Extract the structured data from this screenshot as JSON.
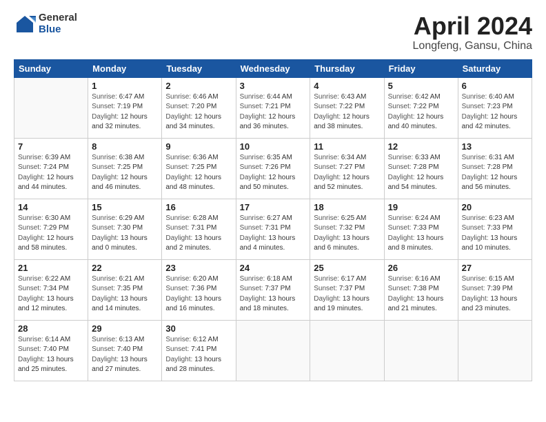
{
  "header": {
    "logo_general": "General",
    "logo_blue": "Blue",
    "title": "April 2024",
    "location": "Longfeng, Gansu, China"
  },
  "calendar": {
    "days_of_week": [
      "Sunday",
      "Monday",
      "Tuesday",
      "Wednesday",
      "Thursday",
      "Friday",
      "Saturday"
    ],
    "weeks": [
      [
        {
          "day": "",
          "sunrise": "",
          "sunset": "",
          "daylight": ""
        },
        {
          "day": "1",
          "sunrise": "6:47 AM",
          "sunset": "7:19 PM",
          "daylight": "12 hours and 32 minutes."
        },
        {
          "day": "2",
          "sunrise": "6:46 AM",
          "sunset": "7:20 PM",
          "daylight": "12 hours and 34 minutes."
        },
        {
          "day": "3",
          "sunrise": "6:44 AM",
          "sunset": "7:21 PM",
          "daylight": "12 hours and 36 minutes."
        },
        {
          "day": "4",
          "sunrise": "6:43 AM",
          "sunset": "7:22 PM",
          "daylight": "12 hours and 38 minutes."
        },
        {
          "day": "5",
          "sunrise": "6:42 AM",
          "sunset": "7:22 PM",
          "daylight": "12 hours and 40 minutes."
        },
        {
          "day": "6",
          "sunrise": "6:40 AM",
          "sunset": "7:23 PM",
          "daylight": "12 hours and 42 minutes."
        }
      ],
      [
        {
          "day": "7",
          "sunrise": "6:39 AM",
          "sunset": "7:24 PM",
          "daylight": "12 hours and 44 minutes."
        },
        {
          "day": "8",
          "sunrise": "6:38 AM",
          "sunset": "7:25 PM",
          "daylight": "12 hours and 46 minutes."
        },
        {
          "day": "9",
          "sunrise": "6:36 AM",
          "sunset": "7:25 PM",
          "daylight": "12 hours and 48 minutes."
        },
        {
          "day": "10",
          "sunrise": "6:35 AM",
          "sunset": "7:26 PM",
          "daylight": "12 hours and 50 minutes."
        },
        {
          "day": "11",
          "sunrise": "6:34 AM",
          "sunset": "7:27 PM",
          "daylight": "12 hours and 52 minutes."
        },
        {
          "day": "12",
          "sunrise": "6:33 AM",
          "sunset": "7:28 PM",
          "daylight": "12 hours and 54 minutes."
        },
        {
          "day": "13",
          "sunrise": "6:31 AM",
          "sunset": "7:28 PM",
          "daylight": "12 hours and 56 minutes."
        }
      ],
      [
        {
          "day": "14",
          "sunrise": "6:30 AM",
          "sunset": "7:29 PM",
          "daylight": "12 hours and 58 minutes."
        },
        {
          "day": "15",
          "sunrise": "6:29 AM",
          "sunset": "7:30 PM",
          "daylight": "13 hours and 0 minutes."
        },
        {
          "day": "16",
          "sunrise": "6:28 AM",
          "sunset": "7:31 PM",
          "daylight": "13 hours and 2 minutes."
        },
        {
          "day": "17",
          "sunrise": "6:27 AM",
          "sunset": "7:31 PM",
          "daylight": "13 hours and 4 minutes."
        },
        {
          "day": "18",
          "sunrise": "6:25 AM",
          "sunset": "7:32 PM",
          "daylight": "13 hours and 6 minutes."
        },
        {
          "day": "19",
          "sunrise": "6:24 AM",
          "sunset": "7:33 PM",
          "daylight": "13 hours and 8 minutes."
        },
        {
          "day": "20",
          "sunrise": "6:23 AM",
          "sunset": "7:33 PM",
          "daylight": "13 hours and 10 minutes."
        }
      ],
      [
        {
          "day": "21",
          "sunrise": "6:22 AM",
          "sunset": "7:34 PM",
          "daylight": "13 hours and 12 minutes."
        },
        {
          "day": "22",
          "sunrise": "6:21 AM",
          "sunset": "7:35 PM",
          "daylight": "13 hours and 14 minutes."
        },
        {
          "day": "23",
          "sunrise": "6:20 AM",
          "sunset": "7:36 PM",
          "daylight": "13 hours and 16 minutes."
        },
        {
          "day": "24",
          "sunrise": "6:18 AM",
          "sunset": "7:37 PM",
          "daylight": "13 hours and 18 minutes."
        },
        {
          "day": "25",
          "sunrise": "6:17 AM",
          "sunset": "7:37 PM",
          "daylight": "13 hours and 19 minutes."
        },
        {
          "day": "26",
          "sunrise": "6:16 AM",
          "sunset": "7:38 PM",
          "daylight": "13 hours and 21 minutes."
        },
        {
          "day": "27",
          "sunrise": "6:15 AM",
          "sunset": "7:39 PM",
          "daylight": "13 hours and 23 minutes."
        }
      ],
      [
        {
          "day": "28",
          "sunrise": "6:14 AM",
          "sunset": "7:40 PM",
          "daylight": "13 hours and 25 minutes."
        },
        {
          "day": "29",
          "sunrise": "6:13 AM",
          "sunset": "7:40 PM",
          "daylight": "13 hours and 27 minutes."
        },
        {
          "day": "30",
          "sunrise": "6:12 AM",
          "sunset": "7:41 PM",
          "daylight": "13 hours and 28 minutes."
        },
        {
          "day": "",
          "sunrise": "",
          "sunset": "",
          "daylight": ""
        },
        {
          "day": "",
          "sunrise": "",
          "sunset": "",
          "daylight": ""
        },
        {
          "day": "",
          "sunrise": "",
          "sunset": "",
          "daylight": ""
        },
        {
          "day": "",
          "sunrise": "",
          "sunset": "",
          "daylight": ""
        }
      ]
    ],
    "labels": {
      "sunrise": "Sunrise:",
      "sunset": "Sunset:",
      "daylight": "Daylight:"
    }
  }
}
